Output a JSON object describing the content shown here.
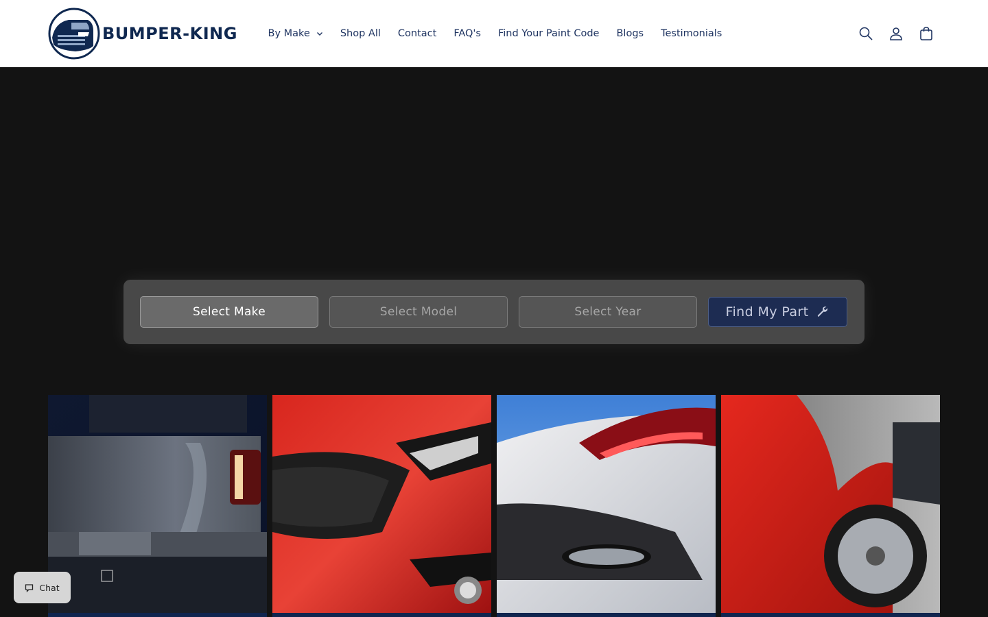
{
  "brand": {
    "name": "BUMPER-KING",
    "logo_icon": "car-front-icon",
    "color": "#0f2850"
  },
  "nav": {
    "items": [
      {
        "label": "By Make",
        "has_dropdown": true
      },
      {
        "label": "Shop All"
      },
      {
        "label": "Contact"
      },
      {
        "label": "FAQ's"
      },
      {
        "label": "Find Your Paint Code"
      },
      {
        "label": "Blogs"
      },
      {
        "label": "Testimonials"
      }
    ]
  },
  "header_icons": [
    "search-icon",
    "account-icon",
    "cart-icon"
  ],
  "finder": {
    "make_label": "Select Make",
    "model_label": "Select Model",
    "year_label": "Select Year",
    "submit_label": "Find My Part",
    "submit_icon": "wrench-icon",
    "submit_color": "#1d2c52"
  },
  "gallery": [
    {
      "name": "pickup-truck-rear-image"
    },
    {
      "name": "red-sports-car-front-image"
    },
    {
      "name": "white-coupe-rear-image"
    },
    {
      "name": "red-sedan-side-image"
    }
  ],
  "chat": {
    "label": "Chat",
    "icon": "chat-bubble-icon"
  }
}
